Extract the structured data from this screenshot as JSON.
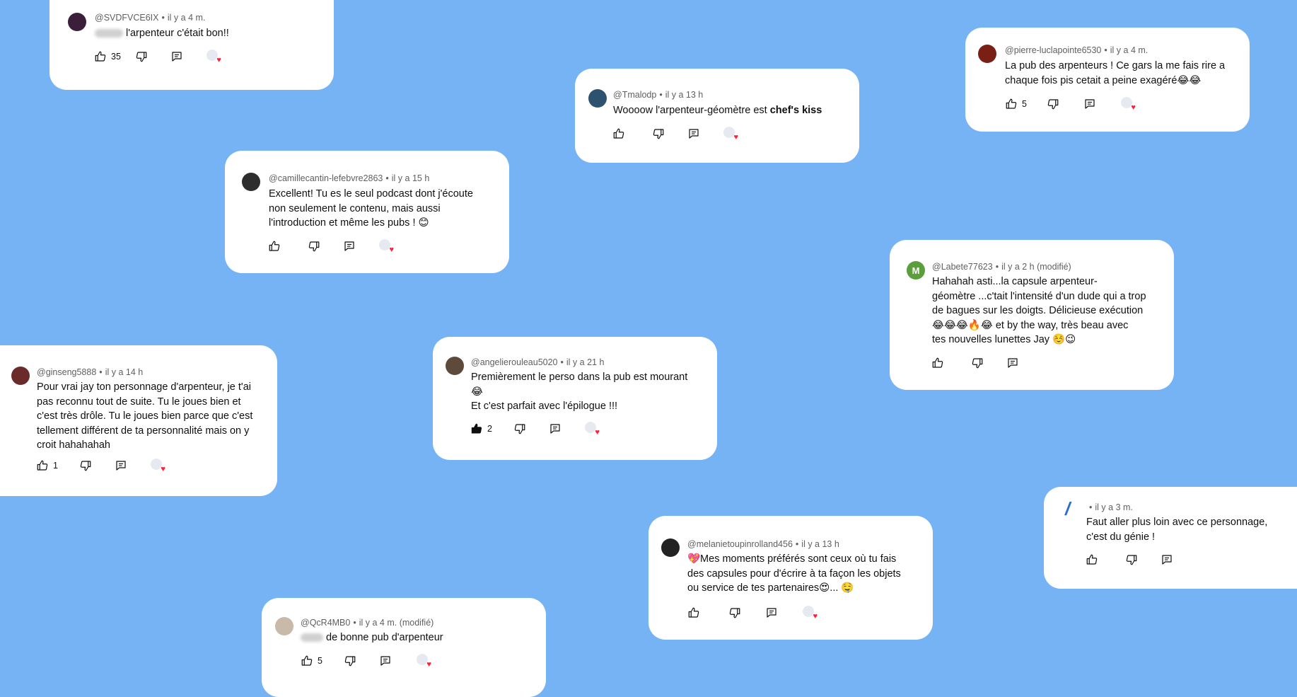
{
  "colors": {
    "background": "#75b3f5",
    "heart": "#ff1f3a",
    "liked": "#0f0f0f"
  },
  "icons": {
    "like": "thumbs-up-icon",
    "dislike": "thumbs-down-icon",
    "reply": "reply-icon",
    "creator_heart": "creator-heart-icon"
  },
  "comments": [
    {
      "author": "@SVDFVCE6IX",
      "time": "il y a 4 m.",
      "lines": [
        "l'arpenteur c'était bon!!"
      ],
      "likes": "35"
    },
    {
      "author": "@Tmalodp",
      "time": "il y a 13 h",
      "text_plain": "Woooow l'arpenteur-géomètre est ",
      "text_bold": "chef's kiss",
      "likes": ""
    },
    {
      "author": "@pierre-luclapointe6530",
      "time": "il y a 4 m.",
      "lines": [
        "La pub des arpenteurs ! Ce gars la me fais rire a",
        "chaque fois pis cetait a peine exagéré😂😂"
      ],
      "likes": "5"
    },
    {
      "author": "@camillecantin-lefebvre2863",
      "time": "il y a 15 h",
      "lines": [
        "Excellent! Tu es le seul podcast dont j'écoute",
        "non seulement le contenu, mais aussi",
        "l'introduction et même les pubs ! 😊"
      ],
      "likes": ""
    },
    {
      "author": "@Labete77623",
      "avatar_letter": "M",
      "time": "il y a 2 h (modifié)",
      "lines": [
        "Hahahah asti...la capsule arpenteur-",
        "géomètre ...c'tait l'intensité d'un dude qui a trop",
        "de bagues sur les doigts. Délicieuse exécution",
        "😂😂😂🔥😂 et by the way, très beau avec",
        "tes nouvelles lunettes Jay ☺️😉"
      ],
      "likes": ""
    },
    {
      "author": "@ginseng5888",
      "time": "il y a 14 h",
      "lines": [
        "Pour vrai jay ton personnage d'arpenteur, je t'ai",
        "pas reconnu tout de suite. Tu le joues bien et",
        "c'est très drôle. Tu le joues bien parce que c'est",
        "tellement différent de ta personnalité mais on y",
        "croit hahahahah"
      ],
      "likes": "1"
    },
    {
      "author": "@angelierouleau5020",
      "time": "il y a 21 h",
      "lines": [
        "Premièrement le perso dans la pub est mourant",
        "😂",
        "Et c'est parfait avec l'épilogue !!!"
      ],
      "likes": "2"
    },
    {
      "author": "",
      "time": "il y a 3 m.",
      "lines": [
        "Faut aller plus loin avec ce personnage,",
        "c'est du génie !"
      ],
      "likes": ""
    },
    {
      "author": "@melanietoupinrolland456",
      "time": "il y a 13 h",
      "lines": [
        "💖Mes moments préférés sont ceux où tu fais",
        "des capsules pour d'écrire à ta façon les objets",
        "ou service de tes partenaires😍... 🤤"
      ],
      "likes": ""
    },
    {
      "author": "@QcR4MB0",
      "time": "il y a 4 m. (modifié)",
      "lines": [
        "de bonne pub d'arpenteur"
      ],
      "likes": "5"
    }
  ]
}
